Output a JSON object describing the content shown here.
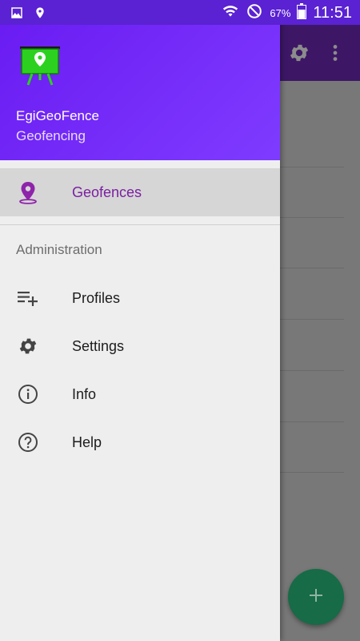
{
  "status_bar": {
    "battery": "67%",
    "time": "11:51",
    "icons": [
      "gallery-icon",
      "location-icon",
      "wifi-icon",
      "do-not-disturb-icon",
      "battery-icon"
    ]
  },
  "drawer": {
    "header": {
      "app_name": "EgiGeoFence",
      "subtitle": "Geofencing",
      "logo_icon": "presentation-board-location-icon"
    },
    "primary_items": [
      {
        "label": "Geofences",
        "icon": "map-pin-icon",
        "selected": true
      }
    ],
    "section_title": "Administration",
    "admin_items": [
      {
        "label": "Profiles",
        "icon": "playlist-add-icon"
      },
      {
        "label": "Settings",
        "icon": "gear-icon"
      },
      {
        "label": "Info",
        "icon": "info-icon"
      },
      {
        "label": "Help",
        "icon": "help-icon"
      }
    ]
  },
  "background_app": {
    "toolbar_icons": [
      "gear-icon",
      "more-vert-icon"
    ],
    "fab_icon": "plus-icon"
  },
  "colors": {
    "status_bar": "#5a22d2",
    "header_gradient_start": "#6a1cf2",
    "header_gradient_end": "#7f3bff",
    "selected_text": "#7b1fa2",
    "selected_bg": "#d6d6d6",
    "fab": "#176b47"
  }
}
